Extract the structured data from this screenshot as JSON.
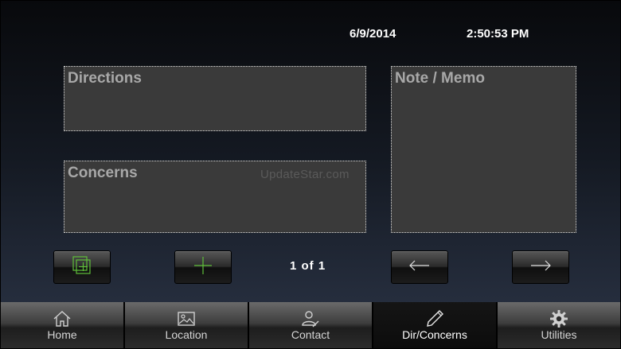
{
  "header": {
    "date": "6/9/2014",
    "time": "2:50:53 PM"
  },
  "fields": {
    "directions": "Directions",
    "concerns": "Concerns",
    "note_memo": "Note / Memo"
  },
  "watermark": "UpdateStar.com",
  "pager": "1  of  1",
  "tabs": [
    {
      "label": "Home",
      "icon": "home-icon"
    },
    {
      "label": "Location",
      "icon": "image-icon"
    },
    {
      "label": "Contact",
      "icon": "contact-icon"
    },
    {
      "label": "Dir/Concerns",
      "icon": "pencil-icon"
    },
    {
      "label": "Utilities",
      "icon": "gear-icon"
    }
  ],
  "colors": {
    "accent_green": "#5fbf3a",
    "field_bg": "#3a3a3a"
  }
}
